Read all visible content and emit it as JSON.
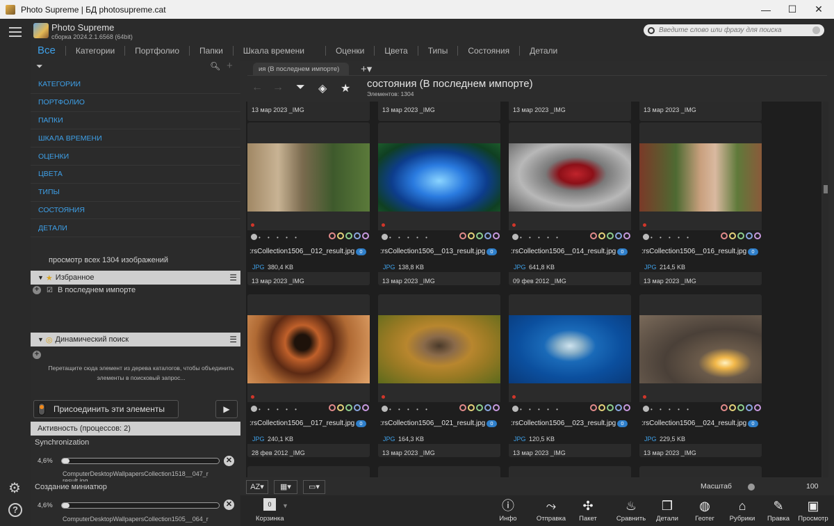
{
  "window": {
    "title": "Photo Supreme | БД photosupreme.cat",
    "minimize": "—",
    "maximize": "☐",
    "close": "✕"
  },
  "app": {
    "name": "Photo Supreme",
    "build": "сборка 2024.2.1.6568 (64bit)"
  },
  "tabs": [
    "Все",
    "Категории",
    "Портфолио",
    "Папки",
    "Шкала времени",
    "Оценки",
    "Цвета",
    "Типы",
    "Состояния",
    "Детали"
  ],
  "search": {
    "placeholder": "Введите слово или фразу для поиска"
  },
  "left": {
    "categories": [
      "КАТЕГОРИИ",
      "ПОРТФОЛИО",
      "ПАПКИ",
      "ШКАЛА ВРЕМЕНИ",
      "ОЦЕНКИ",
      "ЦВЕТА",
      "ТИПЫ",
      "СОСТОЯНИЯ",
      "ДЕТАЛИ"
    ],
    "view_all": "просмотр всех 1304 изображений",
    "favorites_title": "Избранное",
    "favorite_item": "В последнем импорте",
    "dynamic_title": "Динамический поиск",
    "dynamic_hint": "Перетащите сюда элемент из дерева каталогов, чтобы объединить элементы в поисковый запрос...",
    "join_label": "Присоединить эти элементы",
    "activity_title": "Активность (процессов: 2)",
    "processes": [
      {
        "name": "Synchronization",
        "pct": "4,6%",
        "progress": 0.046,
        "file": "ComputerDesktopWallpapersCollection1518__047_r",
        "file2": "result.jpg"
      },
      {
        "name": "Создание миниатюр",
        "pct": "4,6%",
        "progress": 0.046,
        "file": "ComputerDesktopWallpapersCollection1505__064_r",
        "file2": ""
      }
    ]
  },
  "main": {
    "doc_tab": "ия (В последнем импорте)",
    "title": "состояния (В последнем импорте)",
    "count": "Элементов: 1304",
    "top_dates": [
      "13 мар 2023   _IMG",
      "13 мар 2023   _IMG",
      "13 мар 2023   _IMG",
      "13 мар 2023   _IMG"
    ],
    "cards": [
      {
        "name": ":rsCollection1506__012_result.jpg",
        "type": "JPG",
        "size": "380,4 KB",
        "date": "13 мар 2023   _IMG",
        "badge": "0"
      },
      {
        "name": ":rsCollection1506__013_result.jpg",
        "type": "JPG",
        "size": "138,8 KB",
        "date": "13 мар 2023   _IMG",
        "badge": "0"
      },
      {
        "name": ":rsCollection1506__014_result.jpg",
        "type": "JPG",
        "size": "641,8 KB",
        "date": "09 фев 2012   _IMG",
        "badge": "0"
      },
      {
        "name": ":rsCollection1506__016_result.jpg",
        "type": "JPG",
        "size": "214,5 KB",
        "date": "13 мар 2023   _IMG",
        "badge": "0"
      },
      {
        "name": ":rsCollection1506__017_result.jpg",
        "type": "JPG",
        "size": "240,1 KB",
        "date": "28 фев 2012   _IMG",
        "badge": "0"
      },
      {
        "name": ":rsCollection1506__021_result.jpg",
        "type": "JPG",
        "size": "164,3 KB",
        "date": "13 мар 2023   _IMG",
        "badge": "0"
      },
      {
        "name": ":rsCollection1506__023_result.jpg",
        "type": "JPG",
        "size": "120,5 KB",
        "date": "13 мар 2023   _IMG",
        "badge": "0"
      },
      {
        "name": ":rsCollection1506__024_result.jpg",
        "type": "JPG",
        "size": "229,5 KB",
        "date": "13 мар 2023   _IMG",
        "badge": "0"
      }
    ]
  },
  "bottom": {
    "sort": "AZ▾",
    "scale_label": "Масштаб",
    "scale_value": "100"
  },
  "dock": {
    "basket_count": "0",
    "basket": "Корзинка",
    "items": [
      "Инфо",
      "Отправка",
      "Пакет",
      "Сравнить",
      "Детали",
      "Геотег",
      "Рубрики",
      "Правка",
      "Просмотр"
    ]
  }
}
